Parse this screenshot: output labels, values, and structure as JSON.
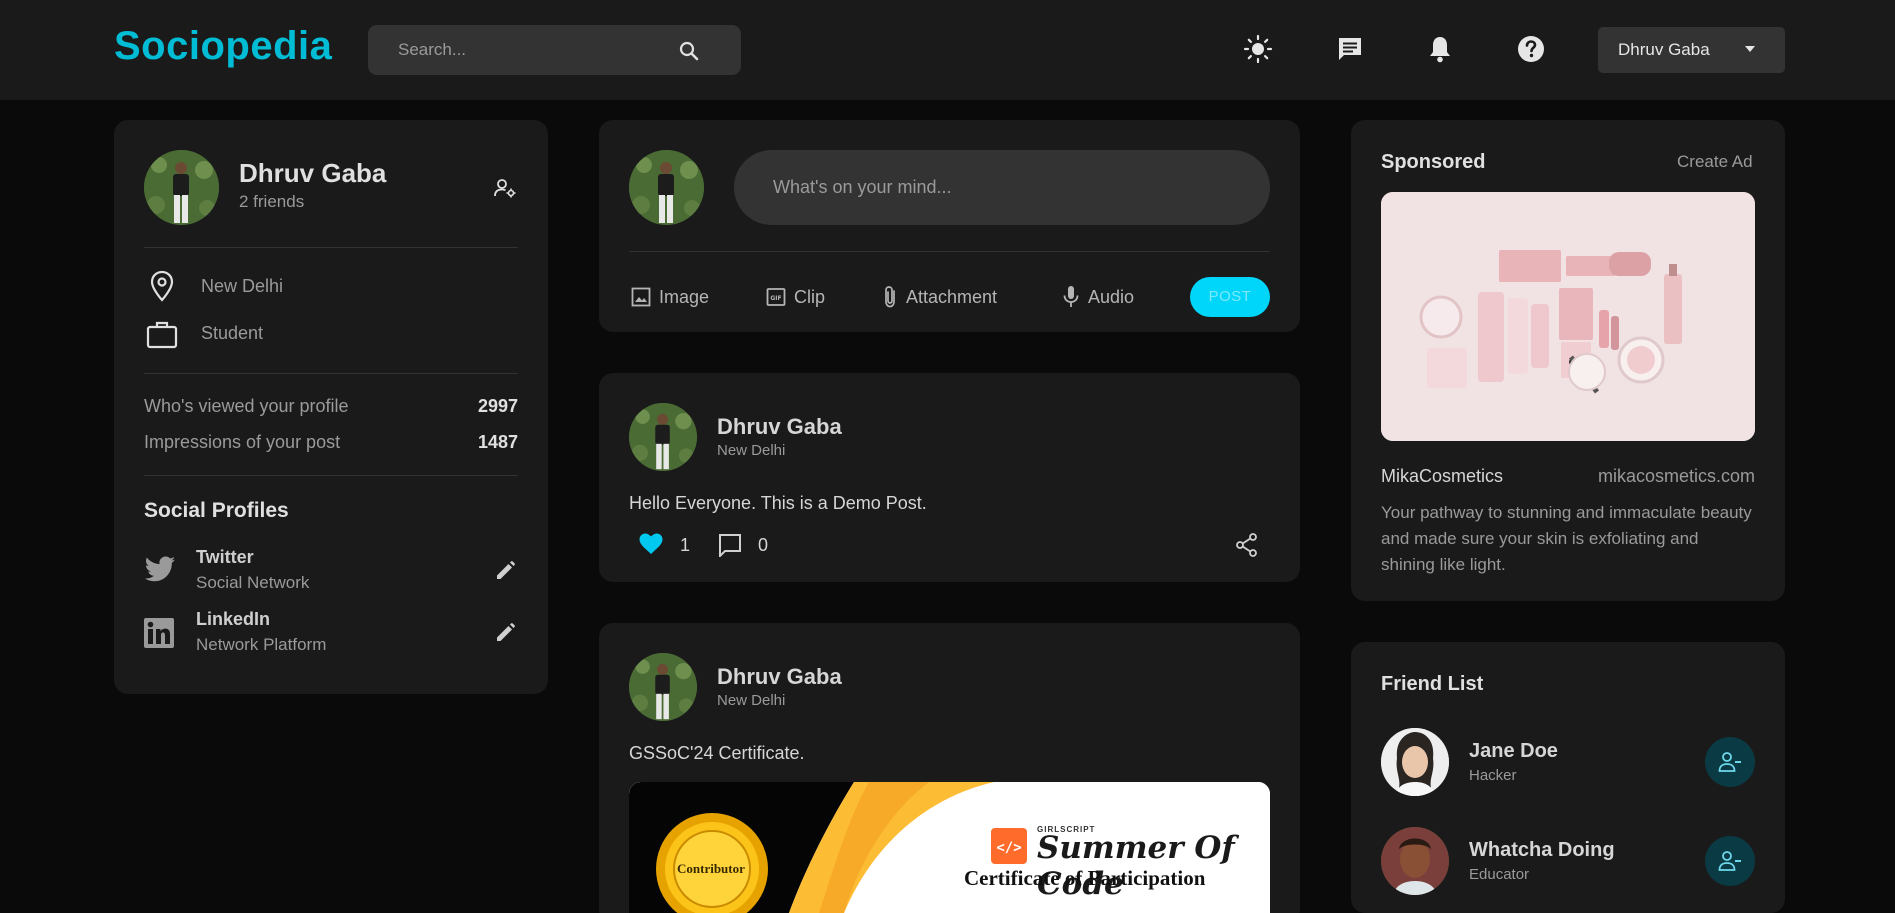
{
  "navbar": {
    "logo": "Sociopedia",
    "search_placeholder": "Search...",
    "user_menu_label": "Dhruv Gaba",
    "icons": [
      "sun-icon",
      "message-icon",
      "bell-icon",
      "help-icon"
    ]
  },
  "profile": {
    "name": "Dhruv Gaba",
    "friends": "2 friends",
    "location": "New Delhi",
    "occupation": "Student",
    "stats": [
      {
        "label": "Who's viewed your profile",
        "value": "2997"
      },
      {
        "label": "Impressions of your post",
        "value": "1487"
      }
    ],
    "social_title": "Social Profiles",
    "socials": [
      {
        "name": "Twitter",
        "type": "Social Network"
      },
      {
        "name": "LinkedIn",
        "type": "Network Platform"
      }
    ]
  },
  "composer": {
    "placeholder": "What's on your mind...",
    "actions": [
      "Image",
      "Clip",
      "Attachment",
      "Audio"
    ],
    "post_label": "POST"
  },
  "posts": [
    {
      "name": "Dhruv Gaba",
      "location": "New Delhi",
      "text": "Hello Everyone. This is a Demo Post.",
      "likes": "1",
      "comments": "0"
    },
    {
      "name": "Dhruv Gaba",
      "location": "New Delhi",
      "text": "GSSoC'24 Certificate.",
      "image_texts": {
        "badge": "Contributor",
        "org": "GIRLSCRIPT",
        "program": "Summer Of Code",
        "title": "Certificate of Participation"
      }
    }
  ],
  "sponsored": {
    "title": "Sponsored",
    "create_ad": "Create Ad",
    "brand": "MikaCosmetics",
    "url": "mikacosmetics.com",
    "description": "Your pathway to stunning and immaculate beauty and made sure your skin is exfoliating and shining like light."
  },
  "friend_list": {
    "title": "Friend List",
    "friends": [
      {
        "name": "Jane Doe",
        "role": "Hacker"
      },
      {
        "name": "Whatcha Doing",
        "role": "Educator"
      }
    ]
  },
  "colors": {
    "accent": "#00bcd4",
    "post_button": "#00d5fa",
    "card_bg": "#1a1a1a",
    "page_bg": "#0a0a0a"
  }
}
